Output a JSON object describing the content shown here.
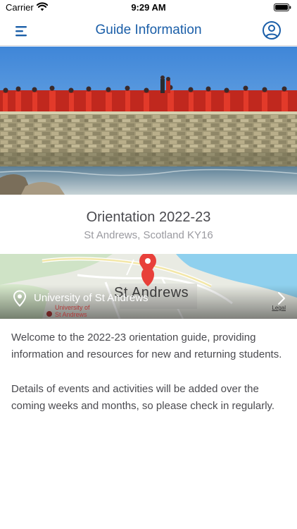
{
  "status_bar": {
    "carrier": "Carrier",
    "time": "9:29 AM",
    "icons": [
      "wifi-icon",
      "battery-icon"
    ]
  },
  "nav": {
    "title": "Guide Information",
    "menu_icon": "hamburger-menu-icon",
    "profile_icon": "profile-icon",
    "accent_color": "#1a5ea8"
  },
  "hero": {
    "description_icon": "hero-photo"
  },
  "event": {
    "title": "Orientation 2022-23",
    "location": "St Andrews, Scotland KY16"
  },
  "map": {
    "location_label": "University of St Andrews",
    "city_label": "St Andrews",
    "poi_label_line1": "University of",
    "poi_label_line2": "St Andrews",
    "legal_label": "Legal"
  },
  "content": {
    "paragraphs": [
      "Welcome to the 2022-23 orientation guide, providing information and resources for new and returning students.",
      "Details of events and activities will be added over the coming weeks and months, so please check in regularly."
    ]
  }
}
